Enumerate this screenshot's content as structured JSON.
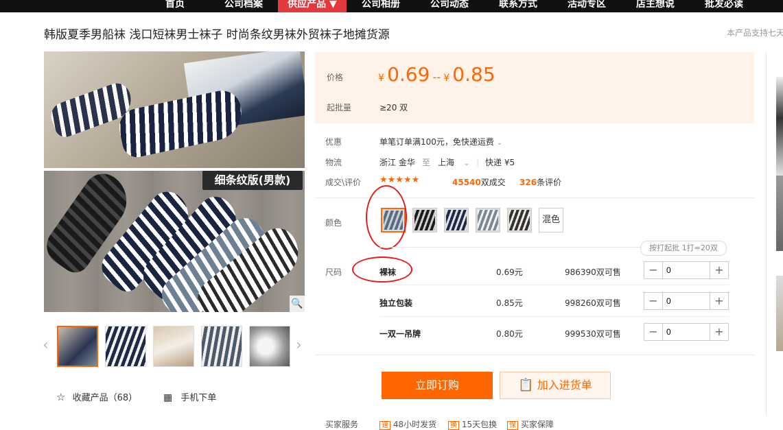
{
  "nav": {
    "items": [
      "首页",
      "公司档案",
      "供应产品 ▼",
      "公司相册",
      "公司动态",
      "联系方式",
      "活动专区",
      "店主想说",
      "批发必读"
    ],
    "active_index": 2,
    "active_color": "#e4393c"
  },
  "product": {
    "title": "韩版夏季男船袜 浅口短袜男士袜子 时尚条纹男袜外贸袜子地摊货源",
    "support_text": "本产品支持七天",
    "image_tag": "细条纹版(男款)"
  },
  "price": {
    "label": "价格",
    "currency": "¥",
    "low": "0.69",
    "separator": "--",
    "high": "0.85",
    "moq_label": "起批量",
    "moq_value": "≥20 双"
  },
  "promo": {
    "label": "优惠",
    "text": "单笔订单满100元，免快递运费"
  },
  "logistics": {
    "label": "物流",
    "from": "浙江 金华",
    "to_word": "至",
    "to": "上海",
    "method": "快递 ¥5"
  },
  "deals": {
    "label": "成交\\评价",
    "stars": "★★★★★",
    "deals_count": "45540",
    "deals_unit": "双成交",
    "reviews_count": "326",
    "reviews_unit": "条评价"
  },
  "color": {
    "label": "颜色",
    "mixed_label": "混色",
    "selected_index": 0
  },
  "size": {
    "label": "尺码",
    "hint": "按打起批 1打=20双",
    "rows": [
      {
        "name": "裸袜",
        "price": "0.69元",
        "stock": "986390",
        "stock_unit": "双可售",
        "qty": "0"
      },
      {
        "name": "独立包装",
        "price": "0.85元",
        "stock": "998260",
        "stock_unit": "双可售",
        "qty": "0"
      },
      {
        "name": "一双一吊牌",
        "price": "0.80元",
        "stock": "999530",
        "stock_unit": "双可售",
        "qty": "0"
      }
    ]
  },
  "actions": {
    "order": "立即订购",
    "cart": "加入进货单",
    "favorite": "收藏产品（68）",
    "mobile": "手机下单"
  },
  "service": {
    "label": "买家服务",
    "items": [
      "48小时发货",
      "15天包换",
      "买家保障"
    ]
  },
  "colors": {
    "accent": "#ff6600",
    "price_bg": "#fff2e8",
    "annotation_red": "#e51c1c"
  }
}
